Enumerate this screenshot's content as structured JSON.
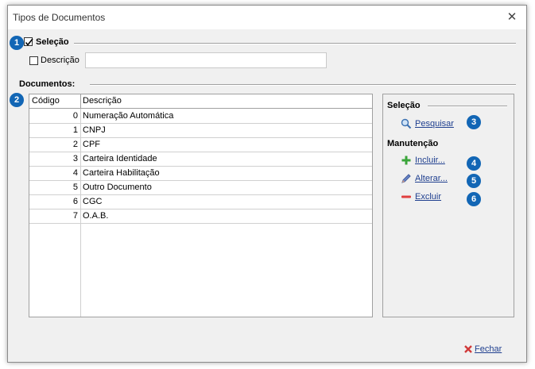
{
  "window": {
    "title": "Tipos de Documentos"
  },
  "selecao": {
    "group_label": "Seleção",
    "checked": true,
    "descricao_label": "Descrição",
    "descricao_value": ""
  },
  "documentos": {
    "label": "Documentos:",
    "columns": [
      "Código",
      "Descrição"
    ],
    "rows": [
      {
        "codigo": "0",
        "descricao": "Numeração Automática"
      },
      {
        "codigo": "1",
        "descricao": "CNPJ"
      },
      {
        "codigo": "2",
        "descricao": "CPF"
      },
      {
        "codigo": "3",
        "descricao": "Carteira Identidade"
      },
      {
        "codigo": "4",
        "descricao": "Carteira Habilitação"
      },
      {
        "codigo": "5",
        "descricao": "Outro Documento"
      },
      {
        "codigo": "6",
        "descricao": "CGC"
      },
      {
        "codigo": "7",
        "descricao": "O.A.B."
      }
    ]
  },
  "side": {
    "selecao_header": "Seleção",
    "pesquisar": "Pesquisar",
    "manutencao_header": "Manutenção",
    "incluir": "Incluir...",
    "alterar": "Alterar...",
    "excluir": "Excluir"
  },
  "badges": [
    "1",
    "2",
    "3",
    "4",
    "5",
    "6"
  ],
  "footer": {
    "fechar": "Fechar"
  },
  "icons": {
    "pesquisar": "magnifier-icon",
    "incluir": "plus-icon",
    "alterar": "pencil-icon",
    "excluir": "minus-icon",
    "fechar": "x-icon"
  },
  "colors": {
    "badge": "#1266b5",
    "link": "#1f3f8f"
  }
}
